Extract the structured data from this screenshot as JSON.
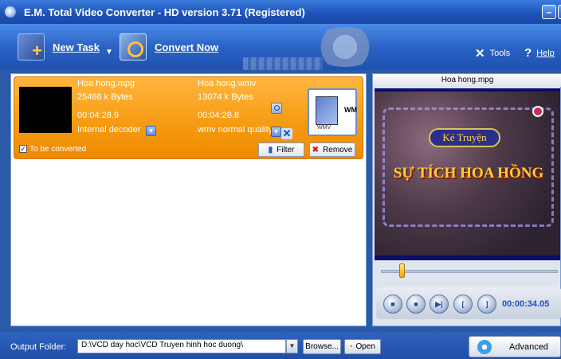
{
  "window": {
    "title": "E.M. Total Video Converter -  HD version 3.71 (Registered)",
    "minimize_glyph": "–",
    "close_glyph": "×"
  },
  "toolbar": {
    "new_task": "New Task",
    "convert_now": "Convert Now",
    "tools": "Tools",
    "help": "Help",
    "dropdown_glyph": "▼"
  },
  "task": {
    "source": {
      "filename": "Hoa hong.mpg",
      "size": "25466 k Bytes",
      "duration": "00:04:28.9",
      "decoder": "Internal decoder"
    },
    "target": {
      "filename": "Hoa hong.wmv",
      "size": "13074 k Bytes",
      "duration": "00:04:28.8",
      "quality": "wmv normal quality",
      "format_icon_text": "WMV",
      "format_side_text": "WM"
    },
    "to_be_converted": "To be converted",
    "checked": true,
    "filter": "Filter",
    "remove": "Remove"
  },
  "preview": {
    "title": "Hoa hong.mpg",
    "video_banner": "Ké Truyện",
    "video_title": "SỰ TÍCH HOA HỒNG",
    "seek_position": 0.12,
    "timecode": "00:00:34.05",
    "controls": [
      "play-button",
      "stop-button",
      "next-frame-button",
      "mark-in-button",
      "mark-out-button"
    ],
    "control_glyphs": [
      "■",
      "■",
      "▶|",
      "[",
      "]"
    ]
  },
  "bottom": {
    "output_folder_label": "Output Folder:",
    "output_folder_value": "D:\\VCD day hoc\\VCD Truyen hinh hoc duong\\",
    "browse": "Browse...",
    "open": "Open",
    "advanced": "Advanced"
  },
  "colors": {
    "title_bar": "#1d52b8",
    "task_bg": "#f59a10",
    "timecode": "#1d4fc2"
  }
}
